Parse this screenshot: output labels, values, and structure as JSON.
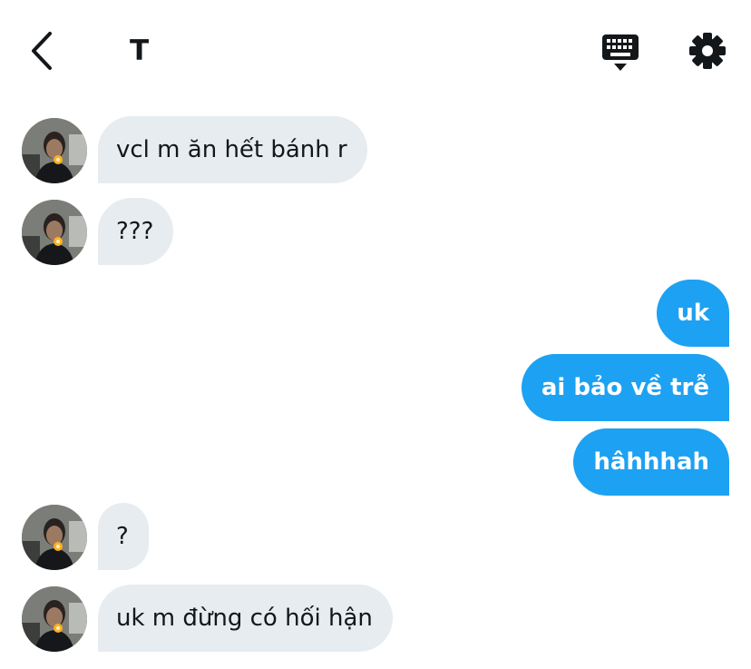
{
  "header": {
    "title": "T",
    "back_icon": "chevron-left-icon",
    "keyboard_icon": "keyboard-icon",
    "settings_icon": "gear-icon"
  },
  "colors": {
    "incoming_bubble": "#e6ecf0",
    "outgoing_bubble": "#1da1f2",
    "text": "#14171a",
    "outgoing_text": "#ffffff"
  },
  "messages": [
    {
      "direction": "incoming",
      "text": "vcl m ăn hết bánh r"
    },
    {
      "direction": "incoming",
      "text": "???"
    },
    {
      "direction": "outgoing",
      "text": "uk"
    },
    {
      "direction": "outgoing",
      "text": "ai bảo về trễ"
    },
    {
      "direction": "outgoing",
      "text": "hâhhhah"
    },
    {
      "direction": "incoming",
      "text": "?"
    },
    {
      "direction": "incoming",
      "text": "uk m đừng có hối hận"
    }
  ]
}
